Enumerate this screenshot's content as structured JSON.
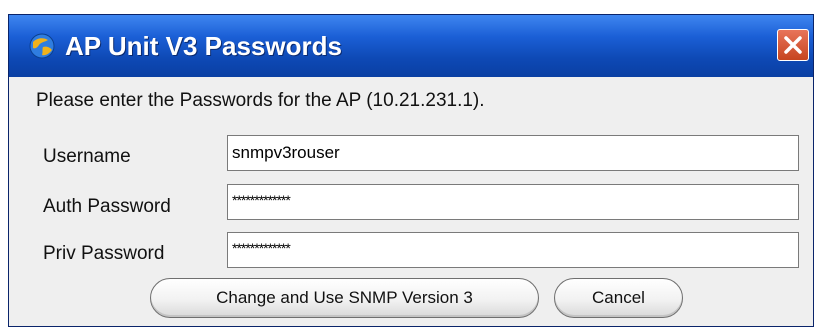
{
  "window": {
    "title": "AP Unit V3 Passwords",
    "title_bar_color": "#1b5fd6",
    "close_button_color": "#d9582f",
    "app_icon": "globe-icon",
    "close_icon": "close-icon"
  },
  "dialog": {
    "prompt": "Please enter the Passwords for the AP (10.21.231.1).",
    "fields": [
      {
        "label": "Username",
        "value": "snmpv3rouser"
      },
      {
        "label": "Auth Password",
        "value": "*************"
      },
      {
        "label": "Priv Password",
        "value": "*************"
      }
    ],
    "buttons": {
      "primary_label": "Change and Use SNMP Version 3",
      "cancel_label": "Cancel"
    }
  }
}
